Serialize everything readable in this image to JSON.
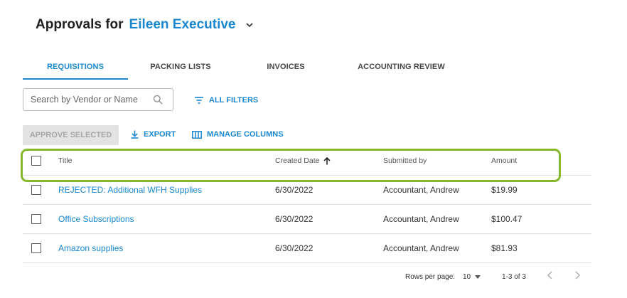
{
  "header": {
    "prefix": "Approvals for",
    "user_name": "Eileen Executive"
  },
  "tabs": [
    {
      "label": "REQUISITIONS",
      "active": true
    },
    {
      "label": "PACKING LISTS",
      "active": false
    },
    {
      "label": "INVOICES",
      "active": false
    },
    {
      "label": "ACCOUNTING REVIEW",
      "active": false
    }
  ],
  "search": {
    "placeholder": "Search by Vendor or Name",
    "value": ""
  },
  "filters": {
    "label": "ALL FILTERS"
  },
  "actions": {
    "approve_label": "APPROVE SELECTED",
    "export_label": "EXPORT",
    "manage_label": "MANAGE COLUMNS"
  },
  "table": {
    "columns": [
      "Title",
      "Created Date",
      "Submitted by",
      "Amount"
    ],
    "sort_column": "Created Date",
    "sort_direction": "ascending",
    "rows": [
      {
        "title": "REJECTED: Additional WFH Supplies",
        "created": "6/30/2022",
        "submitted_by": "Accountant, Andrew",
        "amount": "$19.99"
      },
      {
        "title": "Office Subscriptions",
        "created": "6/30/2022",
        "submitted_by": "Accountant, Andrew",
        "amount": "$100.47"
      },
      {
        "title": "Amazon supplies",
        "created": "6/30/2022",
        "submitted_by": "Accountant, Andrew",
        "amount": "$81.93"
      }
    ]
  },
  "pagination": {
    "rows_per_page_label": "Rows per page:",
    "rows_per_page": "10",
    "range": "1-3 of 3"
  },
  "colors": {
    "accent": "#1a87cf",
    "highlight": "#85b82a",
    "disabled_bg": "#e3e3e3",
    "disabled_text": "#a5a5a5"
  }
}
